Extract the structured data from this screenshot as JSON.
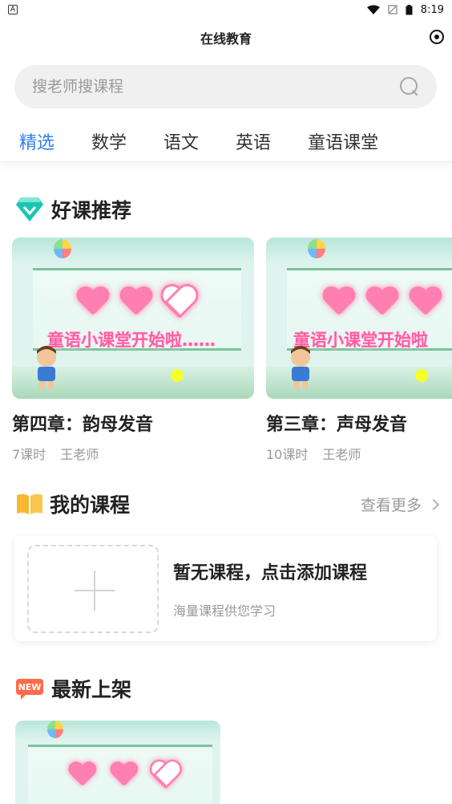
{
  "status_bar": {
    "time": "8:19",
    "left_icon": "notification-a-icon",
    "right_icons": [
      "wifi-icon",
      "sim-off-icon",
      "battery-icon"
    ]
  },
  "header": {
    "title": "在线教育",
    "right_icon": "scan-icon"
  },
  "search": {
    "placeholder": "搜老师搜课程"
  },
  "tabs": [
    {
      "label": "精选",
      "active": true
    },
    {
      "label": "数学",
      "active": false
    },
    {
      "label": "语文",
      "active": false
    },
    {
      "label": "英语",
      "active": false
    },
    {
      "label": "童语课堂",
      "active": false
    }
  ],
  "recommended": {
    "title": "好课推荐",
    "icon": "diamond-icon",
    "courses": [
      {
        "name": "第四章：韵母发音",
        "lessons": "7课时",
        "teacher": "王老师",
        "cover_text": "童语小课堂开始啦……"
      },
      {
        "name": "第三章：声母发音",
        "lessons": "10课时",
        "teacher": "王老师",
        "cover_text": "童语小课堂开始啦"
      }
    ]
  },
  "my_courses": {
    "title": "我的课程",
    "icon": "book-icon",
    "more_label": "查看更多",
    "empty_title": "暂无课程，点击添加课程",
    "empty_subtitle": "海量课程供您学习"
  },
  "new_arrivals": {
    "title": "最新上架",
    "icon": "new-badge-icon",
    "badge_text": "NEW"
  },
  "colors": {
    "accent": "#2f80ed",
    "text": "#222222",
    "muted": "#999999",
    "search_bg": "#f0f0f0"
  }
}
